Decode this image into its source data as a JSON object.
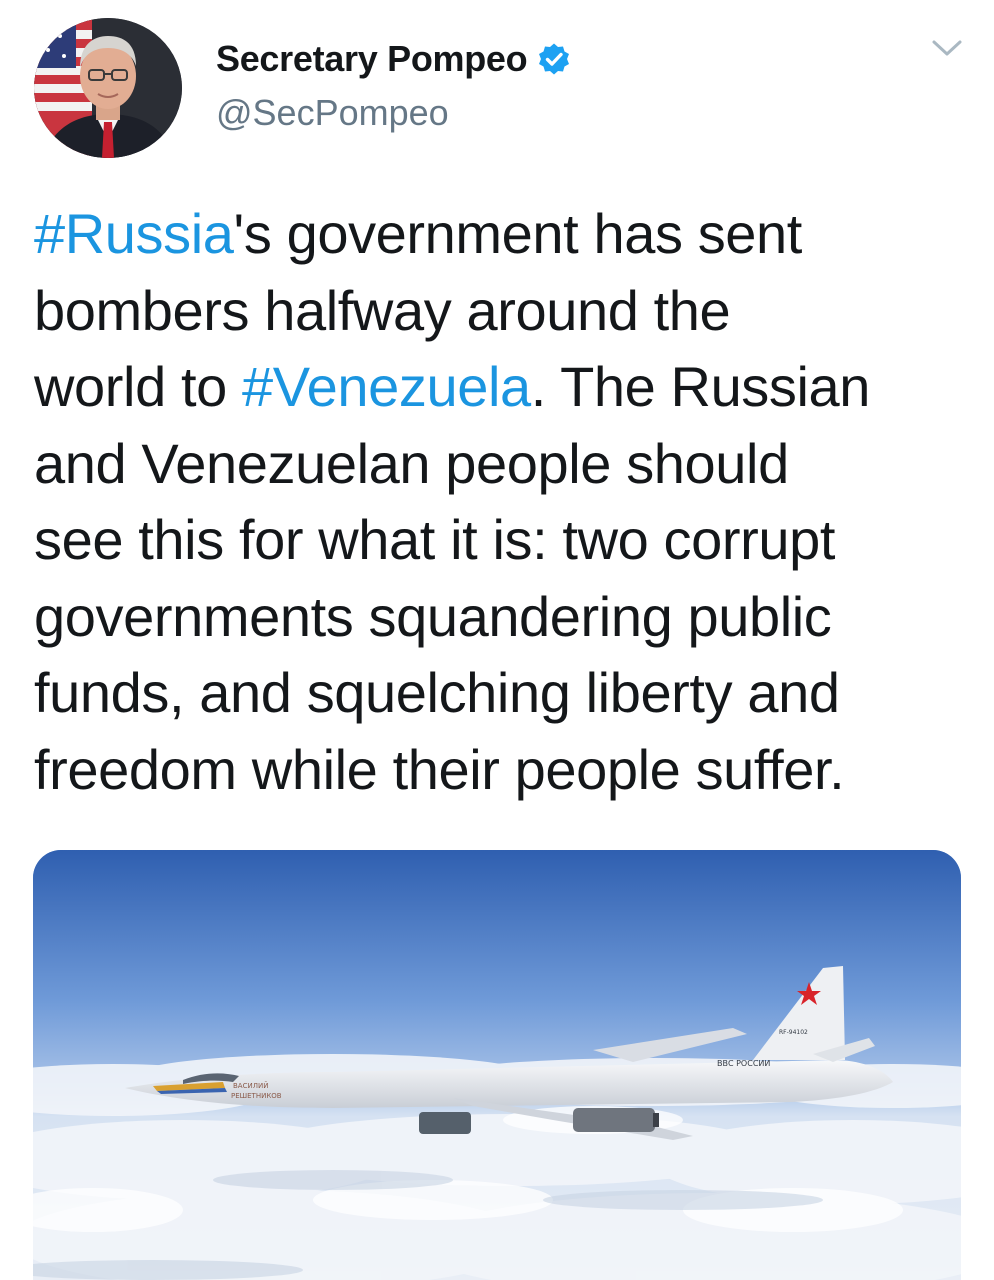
{
  "tweet": {
    "display_name": "Secretary Pompeo",
    "handle": "@SecPompeo",
    "text_lines": [
      [
        {
          "text": "#Russia",
          "hashtag": true
        },
        {
          "text": "'s government has sent",
          "hashtag": false
        }
      ],
      [
        {
          "text": "bombers halfway around the",
          "hashtag": false
        }
      ],
      [
        {
          "text": "world to ",
          "hashtag": false
        },
        {
          "text": "#Venezuela",
          "hashtag": true
        },
        {
          "text": ". The Russian",
          "hashtag": false
        }
      ],
      [
        {
          "text": "and Venezuelan people should",
          "hashtag": false
        }
      ],
      [
        {
          "text": "see this for what it is: two corrupt",
          "hashtag": false
        }
      ],
      [
        {
          "text": "governments squandering public",
          "hashtag": false
        }
      ],
      [
        {
          "text": "funds, and squelching liberty and",
          "hashtag": false
        }
      ],
      [
        {
          "text": "freedom while their people suffer.",
          "hashtag": false
        }
      ]
    ],
    "media": {
      "aircraft_markings": {
        "tail_code": "RF-94102",
        "side_text": "ВВС РОССИИ",
        "nose_name_1": "ВАСИЛИЙ",
        "nose_name_2": "РЕШЕТНИКОВ"
      }
    }
  },
  "icons": {
    "avatar": "avatar",
    "verified": "verified-badge-icon",
    "menu": "chevron-down-icon"
  },
  "colors": {
    "text": "#14171a",
    "secondary": "#657786",
    "link": "#1b95e0",
    "verified": "#1da1f2"
  }
}
